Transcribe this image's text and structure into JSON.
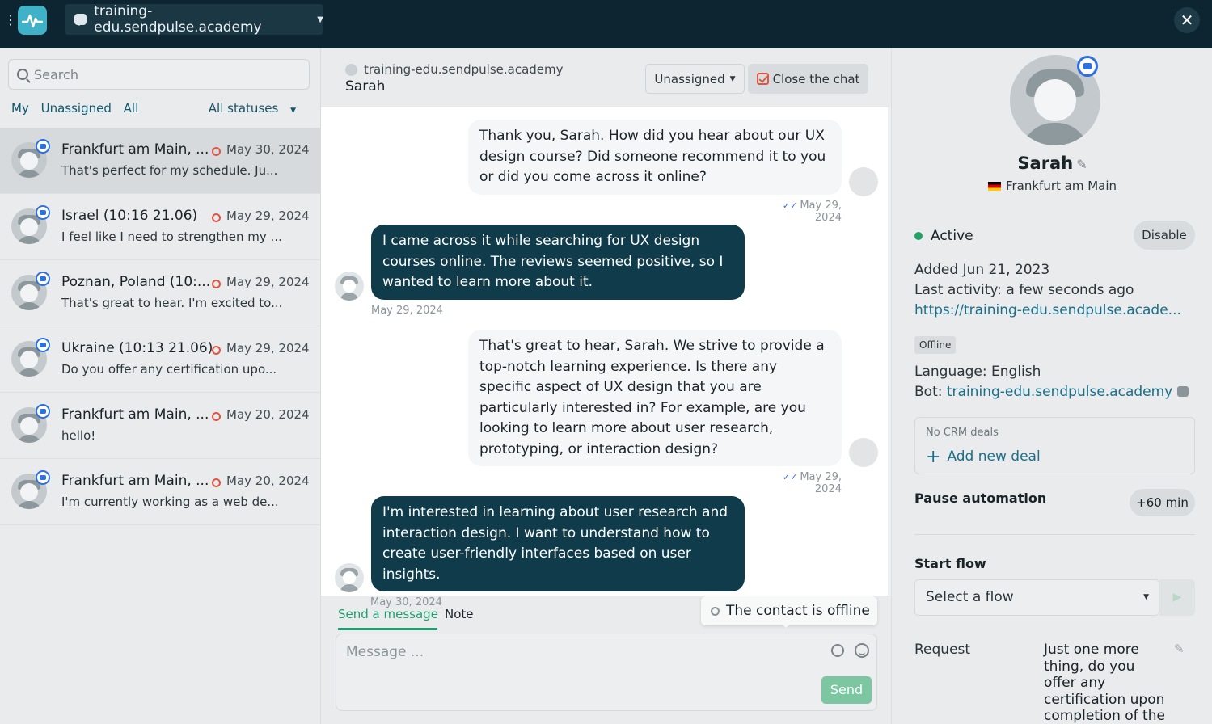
{
  "topbar": {
    "account": "training-edu.sendpulse.academy",
    "close": "✕"
  },
  "sidebar": {
    "search_placeholder": "Search",
    "filters": [
      "My",
      "Unassigned",
      "All"
    ],
    "status_filter": "All statuses",
    "conversations": [
      {
        "name": "Frankfurt am Main, ...",
        "date": "May 30, 2024",
        "preview": "That's perfect for my schedule. Ju..."
      },
      {
        "name": "Israel (10:16 21.06)",
        "date": "May 29, 2024",
        "preview": "I feel like I need to strengthen my ..."
      },
      {
        "name": "Poznan, Poland (10:...",
        "date": "May 29, 2024",
        "preview": "That's great to hear. I'm excited to..."
      },
      {
        "name": "Ukraine (10:13 21.06)",
        "date": "May 29, 2024",
        "preview": "Do you offer any certification upo..."
      },
      {
        "name": "Frankfurt am Main, ...",
        "date": "May 20, 2024",
        "preview": "hello!"
      },
      {
        "name": "Frankfurt am Main, ...",
        "date": "May 20, 2024",
        "preview": "I'm currently working as a web de..."
      }
    ]
  },
  "chat": {
    "account": "training-edu.sendpulse.academy",
    "contact": "Sarah",
    "assign_label": "Unassigned",
    "close_label": "Close the chat",
    "messages": [
      {
        "dir": "out",
        "text": "Thank you, Sarah. How did you hear about our UX design course? Did someone recommend it to you or did you come across it online?",
        "date": "May 29, 2024"
      },
      {
        "dir": "in",
        "text": "I came across it while searching for UX design courses online. The reviews seemed positive, so I wanted to learn more about it.",
        "date": "May 29, 2024"
      },
      {
        "dir": "out",
        "text": "That's great to hear, Sarah. We strive to provide a top-notch learning experience. Is there any specific aspect of UX design that you are particularly interested in? For example, are you looking to learn more about user research, prototyping, or interaction design?",
        "date": "May 29, 2024"
      },
      {
        "dir": "in",
        "text": "I'm interested in learning about user research and interaction design. I want to understand how to create user-friendly interfaces based on user insights.",
        "date": "May 30, 2024"
      }
    ]
  },
  "composer": {
    "tab_send": "Send a message",
    "tab_note": "Note",
    "offline_notice": "The contact is offline",
    "placeholder": "Message ...",
    "send_label": "Send"
  },
  "contact": {
    "name": "Sarah",
    "location": "Frankfurt am Main",
    "status": "Active",
    "disable_label": "Disable",
    "added": "Added Jun 21, 2023",
    "last_activity": "Last activity: a few seconds ago",
    "link": "https://training-edu.sendpulse.acade...",
    "tag": "Offline",
    "language": "Language: English",
    "bot_label": "Bot: ",
    "bot_name": "training-edu.sendpulse.academy",
    "crm_title": "No CRM deals",
    "add_deal": "Add new deal",
    "pause_label": "Pause automation",
    "pause_button": "+60 min",
    "start_flow": "Start flow",
    "flow_placeholder": "Select a flow",
    "request_label": "Request",
    "request_value": "Just one more thing, do you offer any certification upon completion of the course?"
  },
  "colors": {
    "topbar": "#0d2530",
    "incoming_bubble": "#0f3b4b",
    "accent_green": "#1f9e6e",
    "link": "#1a6f8a",
    "offline_ring": "#e05544"
  }
}
